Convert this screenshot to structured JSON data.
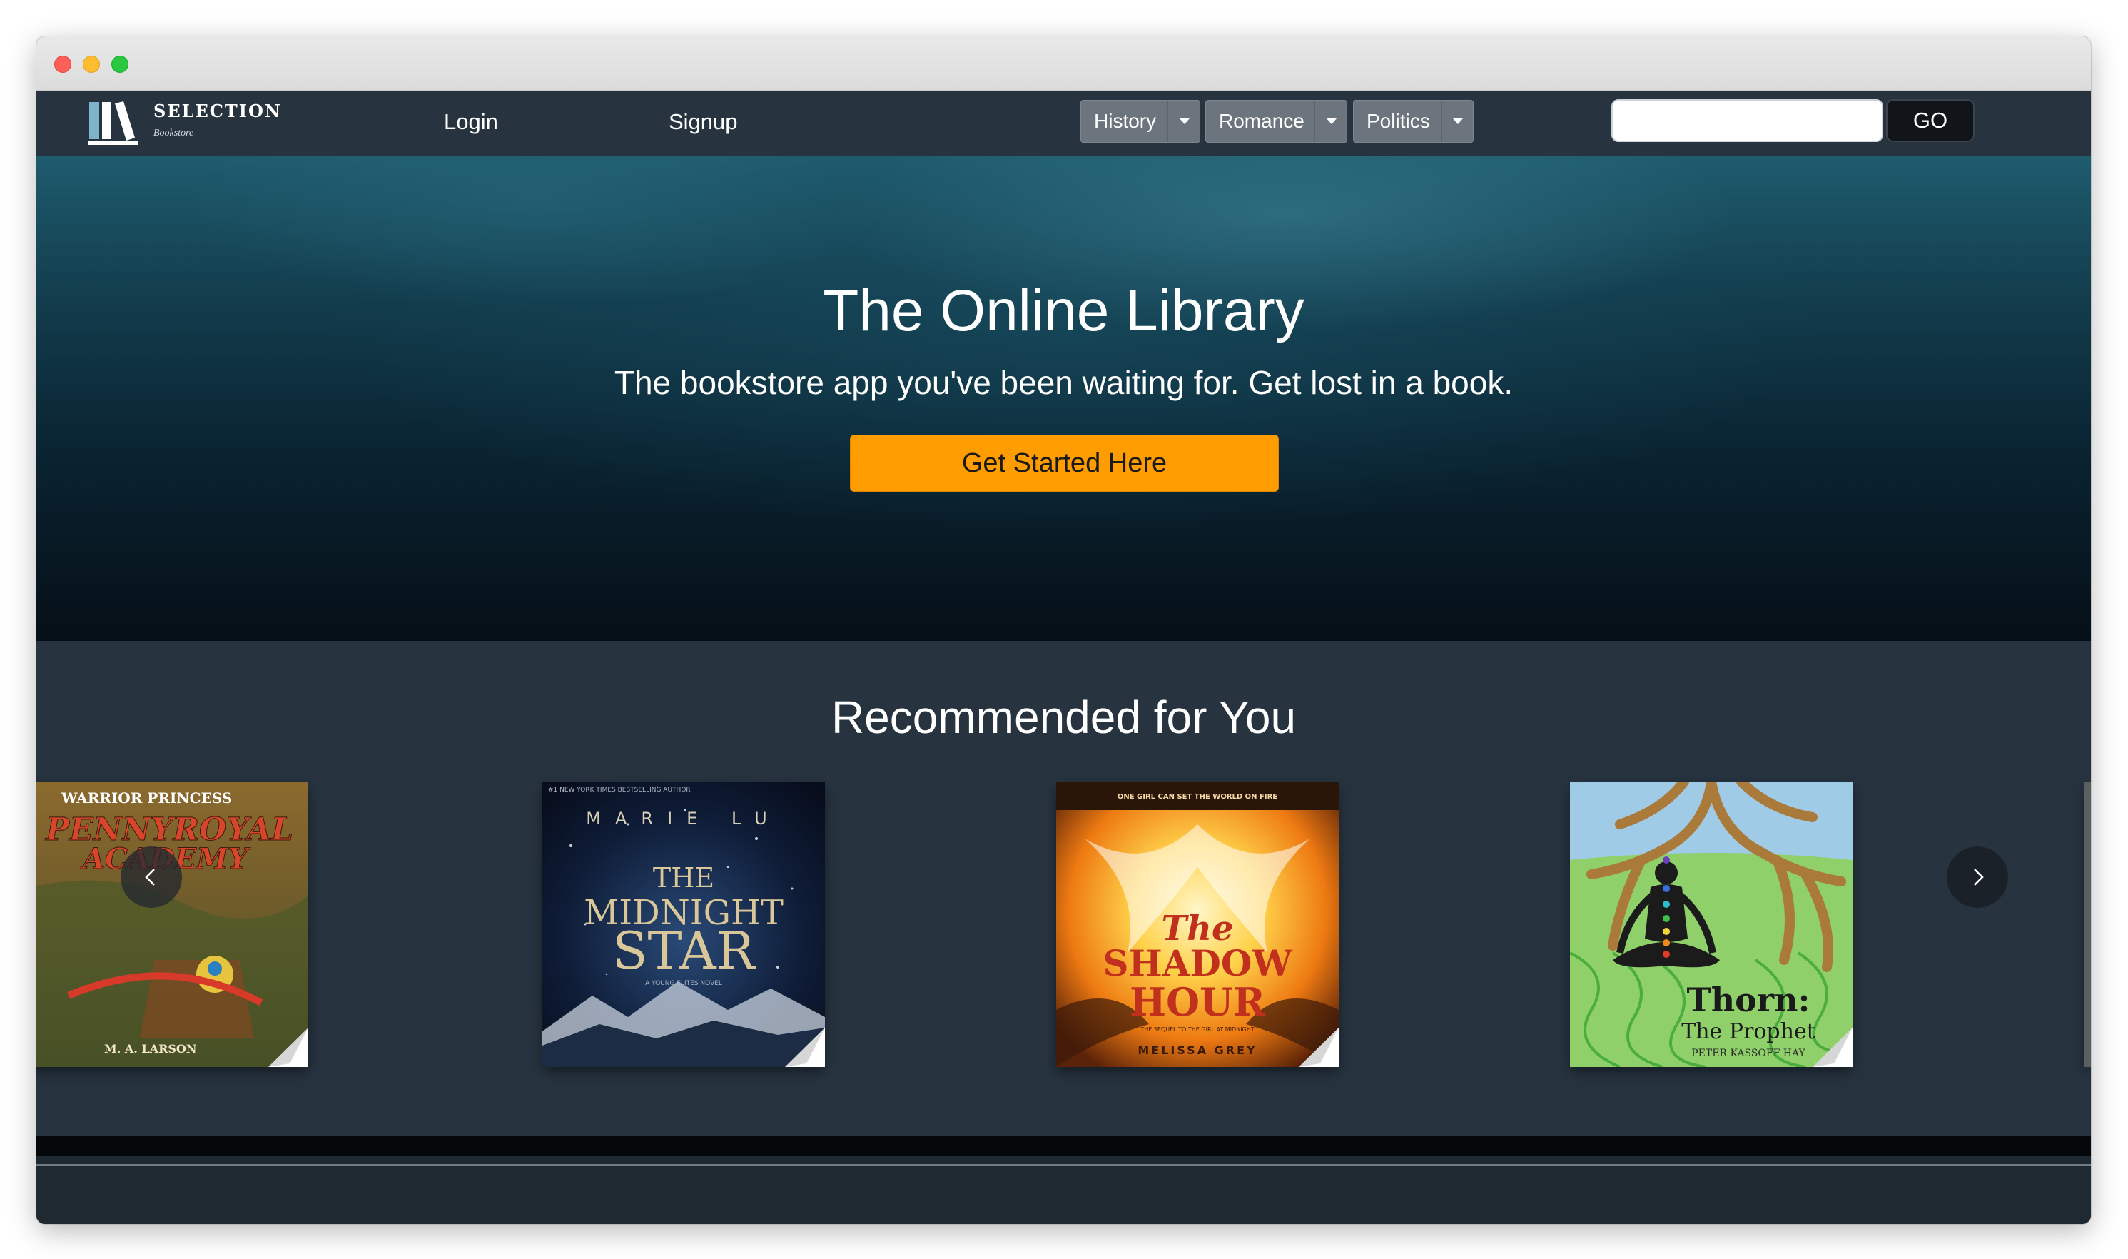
{
  "brand": {
    "name": "SELECTION",
    "subtitle": "Bookstore",
    "logo_icon": "books-icon"
  },
  "nav": {
    "login_label": "Login",
    "signup_label": "Signup"
  },
  "genres": [
    {
      "label": "History"
    },
    {
      "label": "Romance"
    },
    {
      "label": "Politics"
    }
  ],
  "search": {
    "value": "",
    "button_label": "GO"
  },
  "hero": {
    "title": "The Online Library",
    "subtitle": "The bookstore app you've been waiting for. Get lost in a book.",
    "cta_label": "Get Started Here"
  },
  "recommended": {
    "title": "Recommended for You",
    "prev_icon": "chevron-left-icon",
    "next_icon": "chevron-right-icon",
    "books": [
      {
        "series": "WARRIOR PRINCESS",
        "title_line1": "PENNYROYAL",
        "title_line2": "ACADEMY",
        "author": "M. A. LARSON"
      },
      {
        "tagline": "#1 NEW YORK TIMES BESTSELLING AUTHOR",
        "author": "MARIE LU",
        "title_line1": "THE",
        "title_line2": "MIDNIGHT",
        "title_line3": "STAR",
        "series": "A YOUNG ELITES NOVEL"
      },
      {
        "tagline": "ONE GIRL CAN SET THE WORLD ON FIRE",
        "title_line1": "The",
        "title_line2": "SHADOW",
        "title_line3": "HOUR",
        "series": "THE SEQUEL TO THE GIRL AT MIDNIGHT",
        "author": "MELISSA GREY"
      },
      {
        "title_line1": "Thorn:",
        "title_line2": "The Prophet",
        "author": "PETER KASSOFF HAY"
      }
    ]
  },
  "colors": {
    "accent": "#ff9c00",
    "navbar": "#273440",
    "dropdown": "#6c757d"
  }
}
